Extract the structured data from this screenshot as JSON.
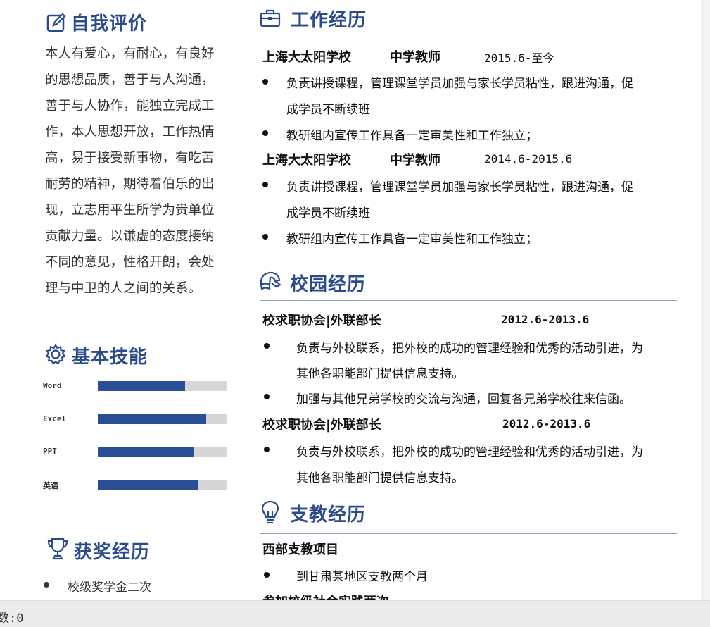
{
  "sections": {
    "self_eval": "自我评价",
    "skills": "基本技能",
    "awards": "获奖经历",
    "work": "工作经历",
    "campus": "校园经历",
    "volunteer": "支教经历"
  },
  "self_eval_lines": [
    "本人有爱心，有耐心，有良好",
    "的思想品质，善于与人沟通，",
    "善于与人协作，能独立完成工",
    "作，本人思想开放，工作热情",
    "高，易于接受新事物，有吃苦",
    "耐劳的精神，期待着伯乐的出",
    "现，立志用平生所学为贵单位",
    "贡献力量。以谦虚的态度接纳",
    "不同的意见，性格开朗，会处",
    "理与中卫的人之间的关系。"
  ],
  "skills": [
    {
      "name": "Word",
      "level": 0.68
    },
    {
      "name": "Excel",
      "level": 0.84
    },
    {
      "name": "PPT",
      "level": 0.75
    },
    {
      "name": "英语",
      "level": 0.78
    }
  ],
  "awards": [
    "校级奖学金二次"
  ],
  "work": [
    {
      "org": "上海大太阳学校",
      "role": "中学教师",
      "date": "2015.6-至今",
      "bullets": [
        [
          "负责讲授课程，管理课堂学员加强与家长学员粘性，跟进沟通，促",
          "成学员不断续班"
        ],
        [
          "教研组内宣传工作具备一定审美性和工作独立；"
        ]
      ]
    },
    {
      "org": "上海大太阳学校",
      "role": "中学教师",
      "date": "2014.6-2015.6",
      "bullets": [
        [
          "负责讲授课程，管理课堂学员加强与家长学员粘性，跟进沟通，促",
          "成学员不断续班"
        ],
        [
          "教研组内宣传工作具备一定审美性和工作独立；"
        ]
      ]
    }
  ],
  "campus": [
    {
      "title": "校求职协会|外联部长",
      "date": "2012.6-2013.6",
      "bullets": [
        [
          "负责与外校联系，把外校的成功的管理经验和优秀的活动引进，为",
          "其他各职能部门提供信息支持。"
        ],
        [
          "加强与其他兄弟学校的交流与沟通，回复各兄弟学校往来信函。"
        ]
      ]
    },
    {
      "title": "校求职协会|外联部长",
      "date": "2012.6-2013.6",
      "bullets": [
        [
          "负责与外校联系，把外校的成功的管理经验和优秀的活动引进，为",
          "其他各职能部门提供信息支持。"
        ]
      ]
    }
  ],
  "volunteer": {
    "project": "西部支教项目",
    "bullet": "到甘肃某地区支教两个月",
    "next_heading": "参加校级社会实践两次"
  },
  "status_text": "数:0",
  "colors": {
    "accent": "#2b4c8c",
    "bar": "#2b4f96",
    "track": "#d6d6d6"
  }
}
